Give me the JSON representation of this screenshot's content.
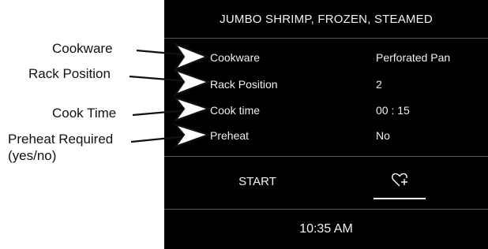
{
  "callouts": {
    "cookware": "Cookware",
    "rack_position": "Rack Position",
    "cook_time": "Cook Time",
    "preheat_line1": "Preheat Required",
    "preheat_line2": "(yes/no)"
  },
  "screen": {
    "title": "JUMBO SHRIMP, FROZEN, STEAMED",
    "rows": [
      {
        "label": "Cookware",
        "value": "Perforated Pan"
      },
      {
        "label": "Rack Position",
        "value": "2"
      },
      {
        "label": "Cook time",
        "value": "00 : 15"
      },
      {
        "label": "Preheat",
        "value": "No"
      }
    ],
    "start_label": "START",
    "favorite_icon": "heart-plus-icon",
    "clock": "10:35 AM"
  },
  "colors": {
    "screen_bg": "#000000",
    "screen_text": "#ffffff",
    "divider": "#555555"
  }
}
